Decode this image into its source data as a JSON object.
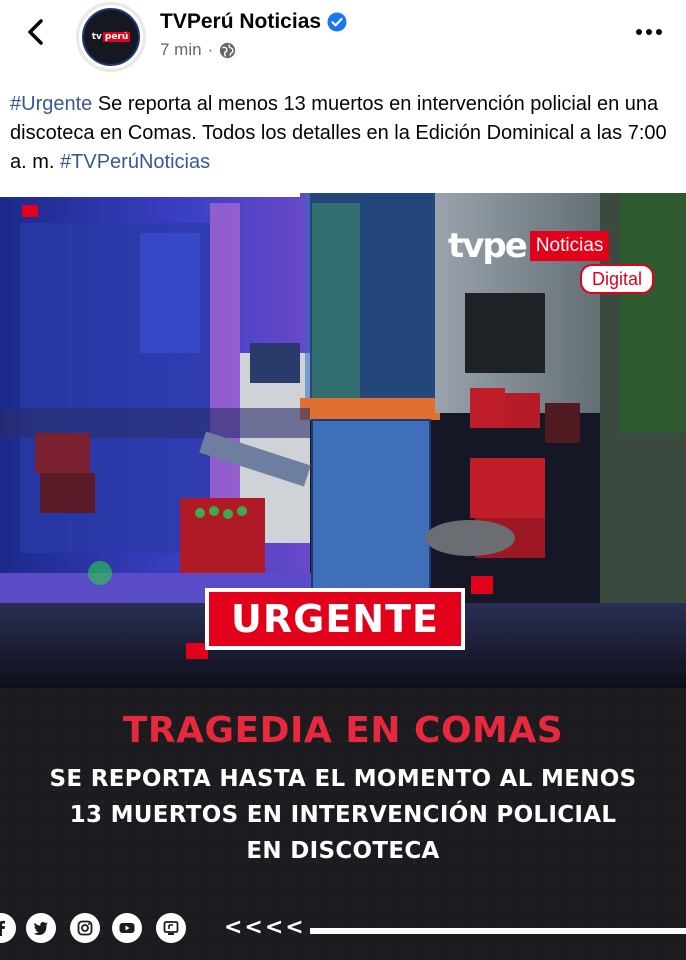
{
  "post": {
    "page_name": "TVPerú Noticias",
    "time_ago": "7 min",
    "separator": "·",
    "avatar_logo": {
      "left": "tv",
      "right": "perú"
    },
    "caption": {
      "hashtag_start": "#Urgente",
      "body": " Se reporta al menos 13 muertos en intervención policial en una discoteca en Comas. Todos los detalles en la Edición Dominical a las 7:00 a. m. ",
      "hashtag_end": "#TVPerúNoticias"
    }
  },
  "media": {
    "brand": {
      "logo": "tvpe",
      "noticias": "Noticias",
      "digital": "Digital"
    },
    "urgente": "URGENTE",
    "headline": "TRAGEDIA EN COMAS",
    "sub_lines": [
      "SE REPORTA HASTA EL MOMENTO AL MENOS",
      "13 MUERTOS EN INTERVENCIÓN POLICIAL",
      "EN DISCOTECA"
    ],
    "chevrons": "<<<<",
    "social_icons": [
      "facebook-icon",
      "twitter-icon",
      "instagram-icon",
      "youtube-icon",
      "tv-icon"
    ]
  },
  "colors": {
    "brand_red": "#e2001a",
    "headline_red": "#e8283c",
    "link_blue": "#385898",
    "verified_blue": "#1877f2",
    "meta_gray": "#65676b"
  }
}
